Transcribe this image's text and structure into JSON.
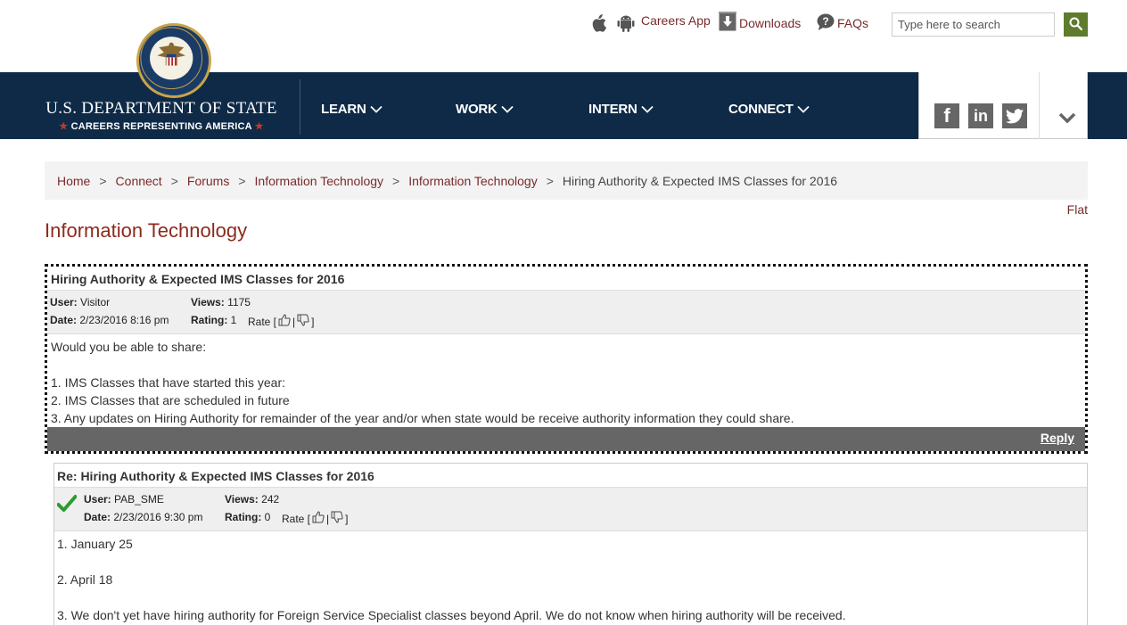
{
  "header": {
    "careers_app_label": "Careers App",
    "downloads_label": "Downloads",
    "faqs_label": "FAQs",
    "search_placeholder": "Type here to search"
  },
  "brand": {
    "title": "U.S. DEPARTMENT OF STATE",
    "subtitle": "CAREERS REPRESENTING AMERICA",
    "seal_text_top": "DEPARTMENT OF STATE",
    "seal_text_bottom": "UNITED STATES OF AMERICA"
  },
  "nav": {
    "items": [
      {
        "label": "LEARN"
      },
      {
        "label": "WORK"
      },
      {
        "label": "INTERN"
      },
      {
        "label": "CONNECT"
      }
    ]
  },
  "social": {
    "facebook": "f",
    "linkedin": "in"
  },
  "breadcrumb": {
    "items": [
      "Home",
      "Connect",
      "Forums",
      "Information Technology",
      "Information Technology"
    ],
    "current": "Hiring Authority & Expected IMS Classes for 2016",
    "separator": ">"
  },
  "view_mode": "Flat",
  "page_title": "Information Technology",
  "posts": [
    {
      "title": "Hiring Authority & Expected IMS Classes for 2016",
      "user_label": "User:",
      "user": "Visitor",
      "date_label": "Date:",
      "date": "2/23/2016 8:16 pm",
      "views_label": "Views:",
      "views": "1175",
      "rating_label": "Rating:",
      "rating": "1",
      "rate_label": "Rate [",
      "rate_sep": "|",
      "rate_end": "]",
      "body": [
        "Would you be able to share:",
        "",
        "1. IMS Classes that have started this year:",
        "2. IMS Classes that are scheduled in future",
        "3. Any updates on Hiring Authority for remainder of the year and/or when state would be receive authority information they could share."
      ],
      "reply_label": "Reply"
    },
    {
      "title": "Re: Hiring Authority & Expected IMS Classes for 2016",
      "user_label": "User:",
      "user": "PAB_SME",
      "date_label": "Date:",
      "date": "2/23/2016 9:30 pm",
      "views_label": "Views:",
      "views": "242",
      "rating_label": "Rating:",
      "rating": "0",
      "rate_label": "Rate [",
      "rate_sep": "|",
      "rate_end": "]",
      "body": [
        "1. January 25",
        "",
        "2. April 18",
        "",
        "3. We don't yet have hiring authority for Foreign Service Specialist classes beyond April. We do not know when hiring authority will be received."
      ]
    }
  ],
  "colors": {
    "navy": "#0e2a47",
    "maroon": "#7a2a2a",
    "title_red": "#8c2a1c",
    "search_green": "#5f7b2e",
    "check_green": "#2e9b2e"
  }
}
